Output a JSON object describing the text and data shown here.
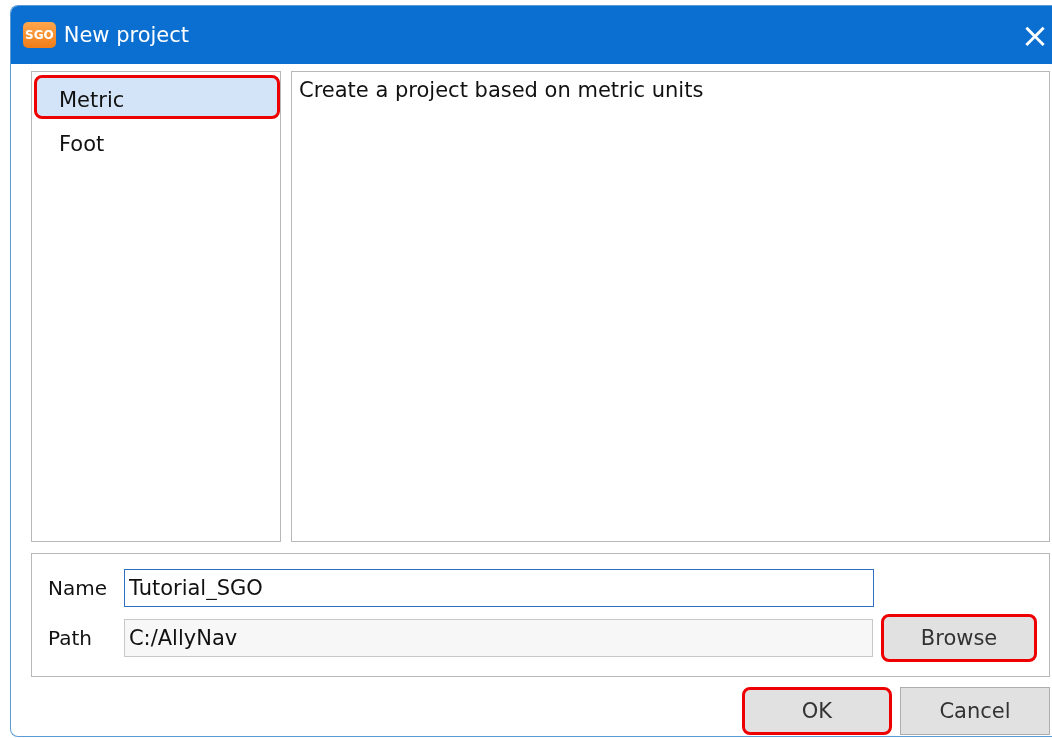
{
  "window": {
    "logo": "SGO",
    "title": "New project",
    "close": "×"
  },
  "templates": [
    {
      "label": "Metric",
      "selected": true,
      "highlighted": true
    },
    {
      "label": "Foot",
      "selected": false,
      "highlighted": false
    }
  ],
  "description": "Create a project based on metric units",
  "fields": [
    {
      "label": "Name",
      "value": "Tutorial_SGO",
      "focused": true
    },
    {
      "label": "Path",
      "value": "C:/AllyNav",
      "focused": false,
      "button": {
        "label": "Browse",
        "highlighted": true
      }
    }
  ],
  "buttons": [
    {
      "label": "OK",
      "highlighted": true
    },
    {
      "label": "Cancel",
      "highlighted": false
    }
  ]
}
